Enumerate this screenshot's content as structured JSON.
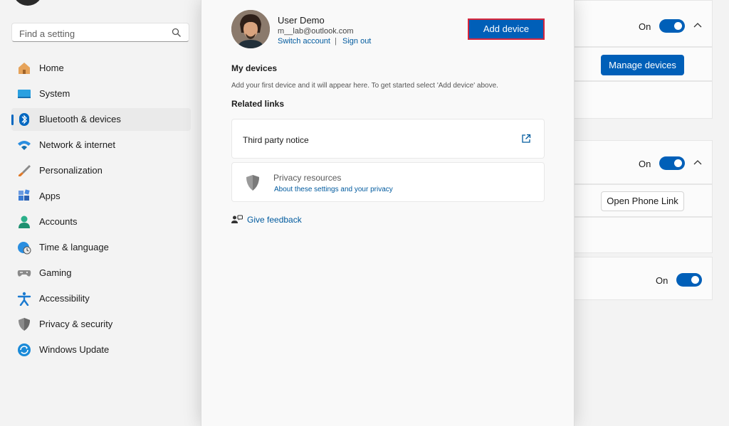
{
  "search": {
    "placeholder": "Find a setting",
    "icon": "search-icon"
  },
  "nav": {
    "items": [
      {
        "label": "Home",
        "icon": "home-icon"
      },
      {
        "label": "System",
        "icon": "system-icon"
      },
      {
        "label": "Bluetooth & devices",
        "icon": "bluetooth-icon",
        "selected": true
      },
      {
        "label": "Network & internet",
        "icon": "wifi-icon"
      },
      {
        "label": "Personalization",
        "icon": "brush-icon"
      },
      {
        "label": "Apps",
        "icon": "apps-icon"
      },
      {
        "label": "Accounts",
        "icon": "person-icon"
      },
      {
        "label": "Time & language",
        "icon": "clock-globe-icon"
      },
      {
        "label": "Gaming",
        "icon": "gamepad-icon"
      },
      {
        "label": "Accessibility",
        "icon": "accessibility-icon"
      },
      {
        "label": "Privacy & security",
        "icon": "shield-icon"
      },
      {
        "label": "Windows Update",
        "icon": "update-icon"
      }
    ]
  },
  "background": {
    "card1": {
      "state": "On",
      "button": "Manage devices"
    },
    "card2": {
      "state": "On",
      "button": "Open Phone Link"
    },
    "card3": {
      "state": "On"
    }
  },
  "dialog": {
    "user_name": "User Demo",
    "user_email": "m__lab@outlook.com",
    "switch_account": "Switch account",
    "separator": "|",
    "sign_out": "Sign out",
    "add_device": "Add device",
    "my_devices_heading": "My devices",
    "my_devices_desc": "Add your first device and it will appear here. To get started select 'Add device' above.",
    "related_heading": "Related links",
    "third_party": "Third party notice",
    "privacy_title": "Privacy resources",
    "privacy_link": "About these settings and your privacy",
    "feedback": "Give feedback"
  },
  "colors": {
    "accent": "#005fb8",
    "link": "#005a9e",
    "highlight_border": "#d7263d"
  }
}
